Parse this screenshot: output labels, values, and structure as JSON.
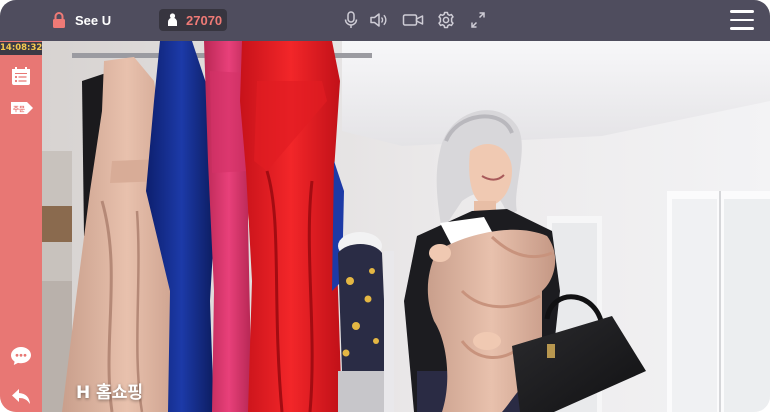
{
  "header": {
    "brand": "See U",
    "viewer_count": "27070",
    "icons": [
      "lock-icon",
      "person-icon",
      "microphone-icon",
      "speaker-icon",
      "video-camera-icon",
      "gear-icon",
      "expand-icon",
      "hamburger-menu-icon"
    ]
  },
  "sidebar": {
    "clock": "14:08:32",
    "tag_label": "주문",
    "icons": [
      "calendar-list-icon",
      "order-tag-icon",
      "chat-bubble-icon",
      "back-arrow-icon"
    ]
  },
  "video": {
    "caption": "H 홈쇼핑"
  },
  "colors": {
    "topbar": "#4f4d5e",
    "sidebar": "#e87774",
    "viewer_count": "#ef7a76",
    "clock_text": "#f4c94e"
  }
}
